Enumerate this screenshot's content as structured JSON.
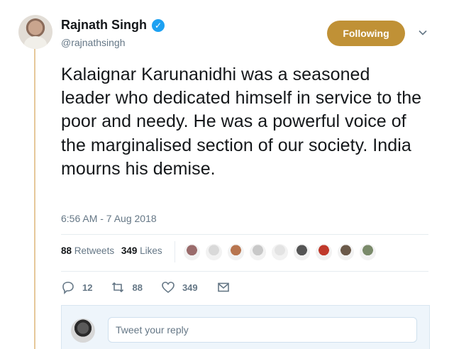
{
  "author": {
    "name": "Rajnath Singh",
    "handle": "@rajnathsingh",
    "verified": true
  },
  "follow_button": {
    "label": "Following",
    "color": "#c09136"
  },
  "tweet": {
    "text": "Kalaignar Karunanidhi was a seasoned leader who dedicated himself in service to the poor and needy. He was a powerful voice of the marginalised section of our society. India mourns his demise.",
    "timestamp": "6:56 AM - 7 Aug 2018"
  },
  "stats": {
    "retweets_count": "88",
    "retweets_label": "Retweets",
    "likes_count": "349",
    "likes_label": "Likes"
  },
  "likers": [
    {
      "icon": "user-avatar",
      "color": "#9a6b6b"
    },
    {
      "icon": "user-avatar",
      "color": "#d9d9d9"
    },
    {
      "icon": "user-avatar",
      "color": "#b8754f"
    },
    {
      "icon": "user-avatar",
      "color": "#c8c8c8"
    },
    {
      "icon": "user-avatar",
      "color": "#e3e3e3"
    },
    {
      "icon": "user-avatar",
      "color": "#555555"
    },
    {
      "icon": "user-avatar",
      "color": "#c0392b"
    },
    {
      "icon": "user-avatar",
      "color": "#6b5a4a"
    },
    {
      "icon": "user-avatar",
      "color": "#7a8a6a"
    }
  ],
  "actions": {
    "reply_count": "12",
    "retweet_count": "88",
    "like_count": "349"
  },
  "reply": {
    "placeholder": "Tweet your reply"
  },
  "colors": {
    "accent_line": "#e6c89a",
    "muted": "#657786",
    "verified": "#1da1f2"
  }
}
